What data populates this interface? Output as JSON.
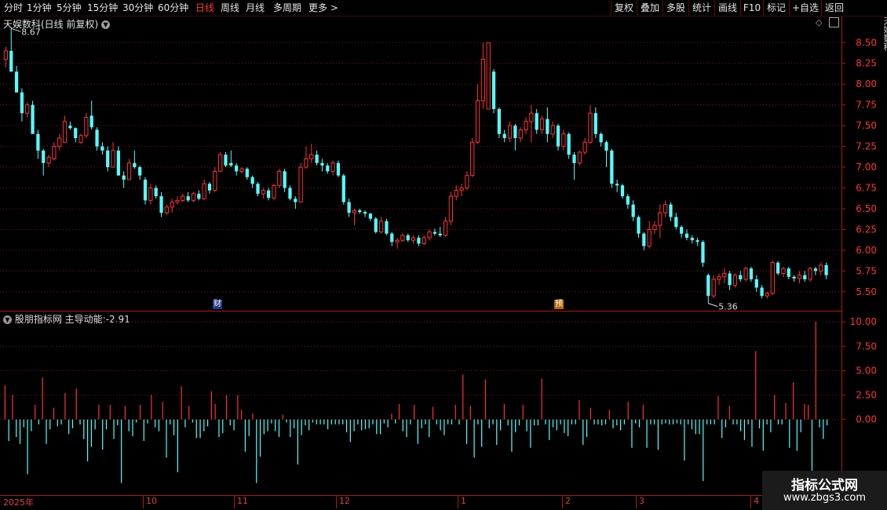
{
  "toolbar": {
    "items": [
      "分时",
      "1分钟",
      "5分钟",
      "15分钟",
      "30分钟",
      "60分钟",
      "日线",
      "周线",
      "月线",
      "多周期",
      "更多 >"
    ],
    "active_index": 6,
    "right_items": [
      "复权",
      "叠加",
      "多股",
      "统计",
      "画线",
      "F10",
      "标记",
      "+自选",
      "返回"
    ]
  },
  "main_chart": {
    "title": "天娱数科(日线 前复权)",
    "max_label": "8.67",
    "min_label": "5.36",
    "marker_cai": "财",
    "marker_yu": "预",
    "y_ticks": [
      "8.50",
      "8.25",
      "8.00",
      "7.75",
      "7.50",
      "7.25",
      "7.00",
      "6.75",
      "6.50",
      "6.25",
      "6.00",
      "5.75",
      "5.50"
    ]
  },
  "indicator": {
    "title": "股朋指标网",
    "name": "主导动能:",
    "value": "-2.91",
    "y_ticks": [
      "10.00",
      "7.50",
      "5.00",
      "2.50",
      "0.00"
    ]
  },
  "dates": {
    "year": "2025年",
    "months": [
      "10",
      "11",
      "12",
      "1",
      "2",
      "3",
      "4"
    ]
  },
  "watermark": {
    "title": "指标公式网",
    "url": "www.zbgs3.com"
  },
  "right_strip_text": "天娱数科",
  "colors": {
    "up": "#ff3232",
    "down": "#54ffff",
    "grid": "#8a1010",
    "axis": "#b01818",
    "active_tab": "#ff3b3b"
  },
  "chart_data": {
    "type": "candlestick",
    "ylim": [
      5.3,
      8.72
    ],
    "candles": [
      {
        "o": 8.3,
        "h": 8.45,
        "l": 8.2,
        "c": 8.4
      },
      {
        "o": 8.4,
        "h": 8.67,
        "l": 8.15,
        "c": 8.15
      },
      {
        "o": 8.15,
        "h": 8.22,
        "l": 7.9,
        "c": 7.9
      },
      {
        "o": 7.9,
        "h": 7.95,
        "l": 7.55,
        "c": 7.65
      },
      {
        "o": 7.65,
        "h": 7.78,
        "l": 7.6,
        "c": 7.75
      },
      {
        "o": 7.75,
        "h": 7.8,
        "l": 7.4,
        "c": 7.4
      },
      {
        "o": 7.4,
        "h": 7.45,
        "l": 7.1,
        "c": 7.2
      },
      {
        "o": 7.2,
        "h": 7.22,
        "l": 6.9,
        "c": 7.05
      },
      {
        "o": 7.05,
        "h": 7.15,
        "l": 7.0,
        "c": 7.12
      },
      {
        "o": 7.1,
        "h": 7.3,
        "l": 7.08,
        "c": 7.25
      },
      {
        "o": 7.25,
        "h": 7.4,
        "l": 7.2,
        "c": 7.35
      },
      {
        "o": 7.3,
        "h": 7.62,
        "l": 7.3,
        "c": 7.55
      },
      {
        "o": 7.5,
        "h": 7.55,
        "l": 7.45,
        "c": 7.47
      },
      {
        "o": 7.47,
        "h": 7.48,
        "l": 7.3,
        "c": 7.35
      },
      {
        "o": 7.3,
        "h": 7.4,
        "l": 7.28,
        "c": 7.38
      },
      {
        "o": 7.38,
        "h": 7.65,
        "l": 7.35,
        "c": 7.6
      },
      {
        "o": 7.62,
        "h": 7.8,
        "l": 7.45,
        "c": 7.48
      },
      {
        "o": 7.45,
        "h": 7.48,
        "l": 7.2,
        "c": 7.25
      },
      {
        "o": 7.25,
        "h": 7.3,
        "l": 7.15,
        "c": 7.2
      },
      {
        "o": 7.2,
        "h": 7.25,
        "l": 6.95,
        "c": 7.0
      },
      {
        "o": 7.0,
        "h": 7.3,
        "l": 7.0,
        "c": 7.2
      },
      {
        "o": 7.2,
        "h": 7.25,
        "l": 6.9,
        "c": 6.9
      },
      {
        "o": 6.9,
        "h": 6.95,
        "l": 6.75,
        "c": 6.85
      },
      {
        "o": 6.85,
        "h": 7.1,
        "l": 6.85,
        "c": 7.05
      },
      {
        "o": 7.05,
        "h": 7.2,
        "l": 6.98,
        "c": 7.0
      },
      {
        "o": 7.0,
        "h": 7.02,
        "l": 6.85,
        "c": 6.9
      },
      {
        "o": 6.85,
        "h": 6.88,
        "l": 6.55,
        "c": 6.6
      },
      {
        "o": 6.6,
        "h": 6.8,
        "l": 6.55,
        "c": 6.75
      },
      {
        "o": 6.75,
        "h": 6.78,
        "l": 6.62,
        "c": 6.65
      },
      {
        "o": 6.65,
        "h": 6.7,
        "l": 6.4,
        "c": 6.45
      },
      {
        "o": 6.45,
        "h": 6.55,
        "l": 6.42,
        "c": 6.52
      },
      {
        "o": 6.52,
        "h": 6.62,
        "l": 6.45,
        "c": 6.58
      },
      {
        "o": 6.58,
        "h": 6.65,
        "l": 6.55,
        "c": 6.6
      },
      {
        "o": 6.6,
        "h": 6.68,
        "l": 6.58,
        "c": 6.65
      },
      {
        "o": 6.65,
        "h": 6.7,
        "l": 6.58,
        "c": 6.6
      },
      {
        "o": 6.6,
        "h": 6.7,
        "l": 6.58,
        "c": 6.68
      },
      {
        "o": 6.68,
        "h": 6.72,
        "l": 6.6,
        "c": 6.62
      },
      {
        "o": 6.62,
        "h": 6.85,
        "l": 6.6,
        "c": 6.8
      },
      {
        "o": 6.8,
        "h": 6.82,
        "l": 6.68,
        "c": 6.72
      },
      {
        "o": 6.72,
        "h": 7.0,
        "l": 6.7,
        "c": 6.95
      },
      {
        "o": 6.95,
        "h": 7.18,
        "l": 6.95,
        "c": 7.15
      },
      {
        "o": 7.15,
        "h": 7.18,
        "l": 7.0,
        "c": 7.02
      },
      {
        "o": 7.05,
        "h": 7.2,
        "l": 7.0,
        "c": 7.02
      },
      {
        "o": 7.02,
        "h": 7.05,
        "l": 6.9,
        "c": 6.95
      },
      {
        "o": 6.95,
        "h": 7.0,
        "l": 6.92,
        "c": 6.98
      },
      {
        "o": 6.98,
        "h": 7.0,
        "l": 6.85,
        "c": 6.88
      },
      {
        "o": 6.88,
        "h": 6.9,
        "l": 6.75,
        "c": 6.8
      },
      {
        "o": 6.8,
        "h": 6.82,
        "l": 6.65,
        "c": 6.68
      },
      {
        "o": 6.68,
        "h": 6.75,
        "l": 6.62,
        "c": 6.72
      },
      {
        "o": 6.72,
        "h": 6.75,
        "l": 6.6,
        "c": 6.63
      },
      {
        "o": 6.63,
        "h": 6.8,
        "l": 6.6,
        "c": 6.78
      },
      {
        "o": 6.78,
        "h": 6.98,
        "l": 6.75,
        "c": 6.95
      },
      {
        "o": 6.95,
        "h": 6.98,
        "l": 6.7,
        "c": 6.75
      },
      {
        "o": 6.75,
        "h": 6.78,
        "l": 6.6,
        "c": 6.62
      },
      {
        "o": 6.62,
        "h": 6.65,
        "l": 6.5,
        "c": 6.58
      },
      {
        "o": 6.58,
        "h": 7.05,
        "l": 6.58,
        "c": 7.0
      },
      {
        "o": 7.0,
        "h": 7.25,
        "l": 6.98,
        "c": 7.1
      },
      {
        "o": 7.1,
        "h": 7.28,
        "l": 7.05,
        "c": 7.15
      },
      {
        "o": 7.15,
        "h": 7.2,
        "l": 7.02,
        "c": 7.05
      },
      {
        "o": 7.05,
        "h": 7.1,
        "l": 6.95,
        "c": 7.02
      },
      {
        "o": 7.02,
        "h": 7.05,
        "l": 6.92,
        "c": 6.95
      },
      {
        "o": 6.95,
        "h": 7.08,
        "l": 6.9,
        "c": 7.05
      },
      {
        "o": 7.05,
        "h": 7.08,
        "l": 6.88,
        "c": 6.9
      },
      {
        "o": 6.9,
        "h": 6.92,
        "l": 6.55,
        "c": 6.58
      },
      {
        "o": 6.58,
        "h": 6.62,
        "l": 6.4,
        "c": 6.45
      },
      {
        "o": 6.45,
        "h": 6.5,
        "l": 6.3,
        "c": 6.48
      },
      {
        "o": 6.48,
        "h": 6.5,
        "l": 6.44,
        "c": 6.46
      },
      {
        "o": 6.46,
        "h": 6.48,
        "l": 6.4,
        "c": 6.44
      },
      {
        "o": 6.44,
        "h": 6.45,
        "l": 6.35,
        "c": 6.38
      },
      {
        "o": 6.38,
        "h": 6.4,
        "l": 6.2,
        "c": 6.22
      },
      {
        "o": 6.22,
        "h": 6.4,
        "l": 6.2,
        "c": 6.35
      },
      {
        "o": 6.35,
        "h": 6.38,
        "l": 6.18,
        "c": 6.2
      },
      {
        "o": 6.2,
        "h": 6.22,
        "l": 6.05,
        "c": 6.1
      },
      {
        "o": 6.1,
        "h": 6.15,
        "l": 6.02,
        "c": 6.12
      },
      {
        "o": 6.12,
        "h": 6.2,
        "l": 6.1,
        "c": 6.18
      },
      {
        "o": 6.18,
        "h": 6.2,
        "l": 6.1,
        "c": 6.12
      },
      {
        "o": 6.12,
        "h": 6.18,
        "l": 6.08,
        "c": 6.15
      },
      {
        "o": 6.15,
        "h": 6.18,
        "l": 6.05,
        "c": 6.08
      },
      {
        "o": 6.08,
        "h": 6.18,
        "l": 6.06,
        "c": 6.15
      },
      {
        "o": 6.15,
        "h": 6.25,
        "l": 6.12,
        "c": 6.22
      },
      {
        "o": 6.22,
        "h": 6.26,
        "l": 6.18,
        "c": 6.2
      },
      {
        "o": 6.2,
        "h": 6.28,
        "l": 6.16,
        "c": 6.18
      },
      {
        "o": 6.18,
        "h": 6.4,
        "l": 6.16,
        "c": 6.35
      },
      {
        "o": 6.35,
        "h": 6.7,
        "l": 6.3,
        "c": 6.65
      },
      {
        "o": 6.65,
        "h": 6.78,
        "l": 6.6,
        "c": 6.72
      },
      {
        "o": 6.72,
        "h": 6.8,
        "l": 6.65,
        "c": 6.75
      },
      {
        "o": 6.75,
        "h": 6.95,
        "l": 6.72,
        "c": 6.9
      },
      {
        "o": 6.9,
        "h": 7.35,
        "l": 6.88,
        "c": 7.3
      },
      {
        "o": 7.3,
        "h": 8.0,
        "l": 7.28,
        "c": 7.8
      },
      {
        "o": 7.8,
        "h": 8.5,
        "l": 7.7,
        "c": 8.3
      },
      {
        "o": 7.7,
        "h": 8.5,
        "l": 7.7,
        "c": 8.5
      },
      {
        "o": 8.15,
        "h": 8.18,
        "l": 7.65,
        "c": 7.7
      },
      {
        "o": 7.7,
        "h": 7.72,
        "l": 7.35,
        "c": 7.4
      },
      {
        "o": 7.4,
        "h": 7.45,
        "l": 7.3,
        "c": 7.35
      },
      {
        "o": 7.35,
        "h": 7.55,
        "l": 7.3,
        "c": 7.5
      },
      {
        "o": 7.5,
        "h": 7.52,
        "l": 7.2,
        "c": 7.35
      },
      {
        "o": 7.35,
        "h": 7.48,
        "l": 7.3,
        "c": 7.45
      },
      {
        "o": 7.45,
        "h": 7.6,
        "l": 7.4,
        "c": 7.55
      },
      {
        "o": 7.55,
        "h": 7.75,
        "l": 7.3,
        "c": 7.65
      },
      {
        "o": 7.65,
        "h": 7.7,
        "l": 7.4,
        "c": 7.45
      },
      {
        "o": 7.45,
        "h": 7.62,
        "l": 7.4,
        "c": 7.58
      },
      {
        "o": 7.58,
        "h": 7.72,
        "l": 7.3,
        "c": 7.4
      },
      {
        "o": 7.4,
        "h": 7.55,
        "l": 7.35,
        "c": 7.5
      },
      {
        "o": 7.5,
        "h": 7.52,
        "l": 7.2,
        "c": 7.25
      },
      {
        "o": 7.25,
        "h": 7.45,
        "l": 7.2,
        "c": 7.4
      },
      {
        "o": 7.4,
        "h": 7.42,
        "l": 7.1,
        "c": 7.15
      },
      {
        "o": 7.15,
        "h": 7.18,
        "l": 6.85,
        "c": 7.05
      },
      {
        "o": 7.05,
        "h": 7.2,
        "l": 7.02,
        "c": 7.18
      },
      {
        "o": 7.18,
        "h": 7.35,
        "l": 7.15,
        "c": 7.3
      },
      {
        "o": 7.3,
        "h": 7.75,
        "l": 7.28,
        "c": 7.65
      },
      {
        "o": 7.65,
        "h": 7.72,
        "l": 7.35,
        "c": 7.4
      },
      {
        "o": 7.4,
        "h": 7.42,
        "l": 7.25,
        "c": 7.3
      },
      {
        "o": 7.3,
        "h": 7.32,
        "l": 7.0,
        "c": 7.2
      },
      {
        "o": 7.2,
        "h": 7.22,
        "l": 6.75,
        "c": 6.8
      },
      {
        "o": 6.8,
        "h": 6.85,
        "l": 6.7,
        "c": 6.78
      },
      {
        "o": 6.78,
        "h": 6.8,
        "l": 6.62,
        "c": 6.65
      },
      {
        "o": 6.65,
        "h": 6.68,
        "l": 6.5,
        "c": 6.55
      },
      {
        "o": 6.55,
        "h": 6.6,
        "l": 6.35,
        "c": 6.4
      },
      {
        "o": 6.4,
        "h": 6.42,
        "l": 6.15,
        "c": 6.2
      },
      {
        "o": 6.2,
        "h": 6.22,
        "l": 6.0,
        "c": 6.05
      },
      {
        "o": 6.05,
        "h": 6.35,
        "l": 6.02,
        "c": 6.25
      },
      {
        "o": 6.25,
        "h": 6.35,
        "l": 6.2,
        "c": 6.3
      },
      {
        "o": 6.3,
        "h": 6.55,
        "l": 6.15,
        "c": 6.45
      },
      {
        "o": 6.45,
        "h": 6.6,
        "l": 6.4,
        "c": 6.55
      },
      {
        "o": 6.55,
        "h": 6.58,
        "l": 6.35,
        "c": 6.4
      },
      {
        "o": 6.4,
        "h": 6.45,
        "l": 6.25,
        "c": 6.28
      },
      {
        "o": 6.28,
        "h": 6.3,
        "l": 6.15,
        "c": 6.2
      },
      {
        "o": 6.2,
        "h": 6.25,
        "l": 6.12,
        "c": 6.15
      },
      {
        "o": 6.15,
        "h": 6.18,
        "l": 6.08,
        "c": 6.12
      },
      {
        "o": 6.12,
        "h": 6.15,
        "l": 6.05,
        "c": 6.1
      },
      {
        "o": 6.1,
        "h": 6.12,
        "l": 5.8,
        "c": 5.85
      },
      {
        "o": 5.7,
        "h": 5.72,
        "l": 5.36,
        "c": 5.45
      },
      {
        "o": 5.45,
        "h": 5.7,
        "l": 5.42,
        "c": 5.65
      },
      {
        "o": 5.65,
        "h": 5.72,
        "l": 5.58,
        "c": 5.68
      },
      {
        "o": 5.68,
        "h": 5.78,
        "l": 5.6,
        "c": 5.72
      },
      {
        "o": 5.72,
        "h": 5.75,
        "l": 5.52,
        "c": 5.58
      },
      {
        "o": 5.58,
        "h": 5.72,
        "l": 5.55,
        "c": 5.7
      },
      {
        "o": 5.7,
        "h": 5.75,
        "l": 5.62,
        "c": 5.65
      },
      {
        "o": 5.65,
        "h": 5.8,
        "l": 5.62,
        "c": 5.78
      },
      {
        "o": 5.78,
        "h": 5.8,
        "l": 5.62,
        "c": 5.65
      },
      {
        "o": 5.65,
        "h": 5.7,
        "l": 5.5,
        "c": 5.55
      },
      {
        "o": 5.55,
        "h": 5.58,
        "l": 5.42,
        "c": 5.45
      },
      {
        "o": 5.45,
        "h": 5.5,
        "l": 5.42,
        "c": 5.48
      },
      {
        "o": 5.48,
        "h": 5.88,
        "l": 5.46,
        "c": 5.85
      },
      {
        "o": 5.85,
        "h": 5.87,
        "l": 5.7,
        "c": 5.72
      },
      {
        "o": 5.72,
        "h": 5.8,
        "l": 5.68,
        "c": 5.78
      },
      {
        "o": 5.78,
        "h": 5.8,
        "l": 5.65,
        "c": 5.68
      },
      {
        "o": 5.68,
        "h": 5.7,
        "l": 5.62,
        "c": 5.66
      },
      {
        "o": 5.66,
        "h": 5.75,
        "l": 5.6,
        "c": 5.7
      },
      {
        "o": 5.7,
        "h": 5.75,
        "l": 5.62,
        "c": 5.65
      },
      {
        "o": 5.65,
        "h": 5.8,
        "l": 5.62,
        "c": 5.78
      },
      {
        "o": 5.78,
        "h": 5.8,
        "l": 5.7,
        "c": 5.75
      },
      {
        "o": 5.75,
        "h": 5.85,
        "l": 5.7,
        "c": 5.82
      },
      {
        "o": 5.82,
        "h": 5.85,
        "l": 5.65,
        "c": 5.7
      }
    ],
    "indicator_ylim": [
      -7.5,
      10.5
    ],
    "indicator_values": [
      3.5,
      -2.2,
      2.5,
      -1.8,
      -2.5,
      -0.8,
      -5.6,
      -1.2,
      1.5,
      -0.5,
      4.3,
      -2.5,
      -1.0,
      1.2,
      -0.7,
      -0.5,
      2.7,
      -1.5,
      -0.9,
      3.2,
      -0.5,
      -2.0,
      -4.3,
      -2.8,
      -1.0,
      1.5,
      -3.1,
      -1.0,
      1.5,
      -2.0,
      -0.6,
      -6.5,
      1.4,
      -1.2,
      -1.7,
      -0.3,
      1.5,
      -2.2,
      -0.4,
      2.5,
      -0.8,
      -1.2,
      1.8,
      -3.9,
      -0.5,
      -1.6,
      -5.4,
      3.4,
      -0.8,
      1.4,
      -0.3,
      -1.9,
      -1.9,
      -1.2,
      -0.7,
      2.9,
      1.6,
      -1.8,
      -1.4,
      2.5,
      -0.6,
      -1.1,
      2.5,
      1.0,
      -3.3,
      -1.7,
      0.6,
      -6.5,
      -3.8,
      -1.5,
      -1.2,
      -0.4,
      -1.2,
      -1.8,
      0.5,
      -0.3,
      -1.8,
      -0.9,
      -4.6,
      -1.6,
      -0.6,
      -1.1,
      -0.3,
      -0.5,
      -0.5,
      -0.5,
      -1.0,
      -0.5,
      -0.5,
      -0.5,
      -0.5,
      -1.3,
      -2.3,
      -1.2,
      -0.5,
      -1.1,
      -1.0,
      -0.9,
      -0.5,
      -1.5,
      -1.5,
      -0.4,
      -0.8,
      0.6,
      -0.4,
      1.6,
      -1.2,
      -1.8,
      -0.5,
      1.5,
      -2.5,
      -0.9,
      -0.5,
      -1.8,
      1.3,
      -0.5,
      -1.1,
      -1.6,
      -0.5,
      -0.5,
      1.5,
      -0.5,
      4.6,
      -2.5,
      1.4,
      -3.9,
      -0.5,
      -2.8,
      4.1,
      -0.9,
      -0.5,
      -2.6,
      -1.1,
      1.6,
      -0.6,
      -3.3,
      -1.3,
      -0.6,
      1.5,
      -1.2,
      -2.9,
      -0.6,
      -0.6,
      4.2,
      -0.5,
      -2.1,
      -0.8,
      -1.1,
      -0.5,
      -1.4,
      -1.7,
      -0.5,
      -0.5,
      2.0,
      -2.6,
      -1.8,
      1.2,
      -0.5,
      -0.5,
      -0.6,
      -0.5,
      1.0,
      -0.9,
      -0.6,
      -1.1,
      -0.5,
      1.8,
      -2.9,
      -0.4,
      -0.8,
      1.5,
      -2.9,
      -0.5,
      -0.5,
      -3.1,
      -0.5,
      -0.4,
      -0.5,
      -0.5,
      -0.4,
      -0.5,
      -4.2,
      -0.5,
      -1.0,
      -1.5,
      -1.5,
      -6.3,
      -0.5,
      -0.5,
      -0.5,
      2.4,
      -1.9,
      -0.8,
      1.4,
      -0.5,
      -0.5,
      -1.2,
      -2.1,
      -0.5,
      -2.8,
      7.0,
      -0.9,
      -3.2,
      -0.5,
      -1.3,
      2.5,
      -0.5,
      -0.5,
      1.7,
      -2.9,
      3.8,
      -3.2,
      -1.3,
      1.6,
      1.5,
      -8.6,
      10.0,
      -0.8,
      -2.0,
      -0.6
    ]
  }
}
